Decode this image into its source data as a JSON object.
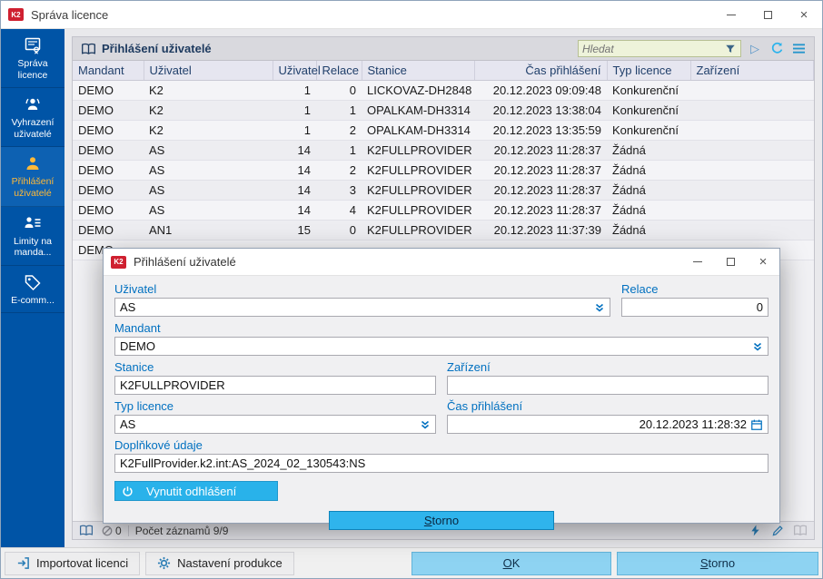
{
  "window": {
    "title": "Správa licence"
  },
  "sidebar": {
    "items": [
      {
        "label": "Správa licence",
        "icon": "license-icon",
        "selected": false
      },
      {
        "label": "Vyhrazení uživatelé",
        "icon": "reserved-users-icon",
        "selected": false
      },
      {
        "label": "Přihlášení uživatelé",
        "icon": "user-icon",
        "selected": true
      },
      {
        "label": "Limity na manda...",
        "icon": "user-list-icon",
        "selected": false
      },
      {
        "label": "E-comm...",
        "icon": "tag-icon",
        "selected": false
      }
    ]
  },
  "panel": {
    "title": "Přihlášení uživatelé",
    "search_placeholder": "Hledat",
    "status": {
      "filtered_count": "0",
      "records_label": "Počet záznamů 9/9"
    }
  },
  "table": {
    "columns": [
      "Mandant",
      "Uživatel",
      "Uživatel",
      "Relace",
      "Stanice",
      "Čas přihlášení",
      "Typ licence",
      "Zařízení"
    ],
    "rows": [
      [
        "DEMO",
        "K2",
        "1",
        "0",
        "LICKOVAZ-DH2848",
        "20.12.2023 09:09:48",
        "Konkurenční",
        ""
      ],
      [
        "DEMO",
        "K2",
        "1",
        "1",
        "OPALKAM-DH3314",
        "20.12.2023 13:38:04",
        "Konkurenční",
        ""
      ],
      [
        "DEMO",
        "K2",
        "1",
        "2",
        "OPALKAM-DH3314",
        "20.12.2023 13:35:59",
        "Konkurenční",
        ""
      ],
      [
        "DEMO",
        "AS",
        "14",
        "1",
        "K2FULLPROVIDER",
        "20.12.2023 11:28:37",
        "Žádná",
        ""
      ],
      [
        "DEMO",
        "AS",
        "14",
        "2",
        "K2FULLPROVIDER",
        "20.12.2023 11:28:37",
        "Žádná",
        ""
      ],
      [
        "DEMO",
        "AS",
        "14",
        "3",
        "K2FULLPROVIDER",
        "20.12.2023 11:28:37",
        "Žádná",
        ""
      ],
      [
        "DEMO",
        "AS",
        "14",
        "4",
        "K2FULLPROVIDER",
        "20.12.2023 11:28:37",
        "Žádná",
        ""
      ],
      [
        "DEMO",
        "AN1",
        "15",
        "0",
        "K2FULLPROVIDER",
        "20.12.2023 11:37:39",
        "Žádná",
        ""
      ],
      [
        "DEMO",
        "",
        "",
        "",
        "",
        "",
        "",
        ""
      ]
    ]
  },
  "dialog": {
    "title": "Přihlášení uživatelé",
    "fields": {
      "uzivatel": {
        "label": "Uživatel",
        "value": "AS"
      },
      "relace": {
        "label": "Relace",
        "value": "0"
      },
      "mandant": {
        "label": "Mandant",
        "value": "DEMO"
      },
      "stanice": {
        "label": "Stanice",
        "value": "K2FULLPROVIDER"
      },
      "zarizeni": {
        "label": "Zařízení",
        "value": ""
      },
      "typ_licence": {
        "label": "Typ licence",
        "value": "AS"
      },
      "cas_prihlaseni": {
        "label": "Čas přihlášení",
        "value": "20.12.2023 11:28:32"
      },
      "doplnkove_udaje": {
        "label": "Doplňkové údaje",
        "value": "K2FullProvider.k2.int:AS_2024_02_130543:NS"
      }
    },
    "buttons": {
      "force_logout": "Vynutit odhlášení",
      "storno": "Storno"
    }
  },
  "bottombar": {
    "import_label": "Importovat licenci",
    "settings_label": "Nastavení produkce",
    "ok_label": "OK",
    "storno_label": "Storno"
  },
  "icons": {
    "search_filter": "funnel",
    "refresh": "circular-arrow",
    "menu": "three-bars",
    "play": "triangle-right",
    "dropdown": "double-chevron-down",
    "calendar": "calendar-grid",
    "power": "power-symbol",
    "logo": "K2"
  },
  "colors": {
    "sidebar_blue": "#0054a6",
    "selected_amber": "#ffb938",
    "accent_cyan": "#2bb3ec",
    "label_blue": "#0070c0",
    "button_cyan_light": "#8ed3f2",
    "logo_red": "#cf2030"
  }
}
